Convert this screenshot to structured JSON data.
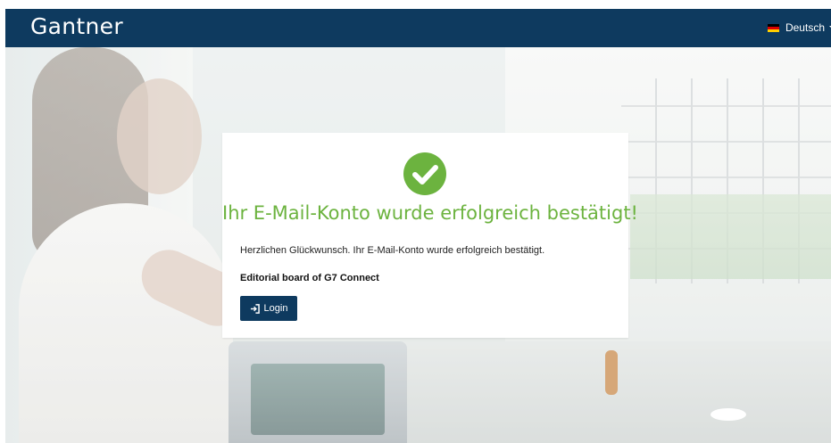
{
  "header": {
    "brand": "Gantner",
    "language": {
      "label": "Deutsch",
      "flag_icon": "germany-flag-icon"
    },
    "background_color": "#0e3a5f"
  },
  "confirmation": {
    "status_icon": "check-circle-icon",
    "title": "Ihr E-Mail-Konto wurde erfolgreich bestätigt!",
    "message": "Herzlichen Glückwunsch. Ihr E-Mail-Konto wurde erfolgreich bestätigt.",
    "signature": "Editorial board of G7 Connect",
    "login_button": {
      "label": "Login",
      "icon": "sign-in-icon"
    },
    "accent_color": "#6cb33f"
  }
}
